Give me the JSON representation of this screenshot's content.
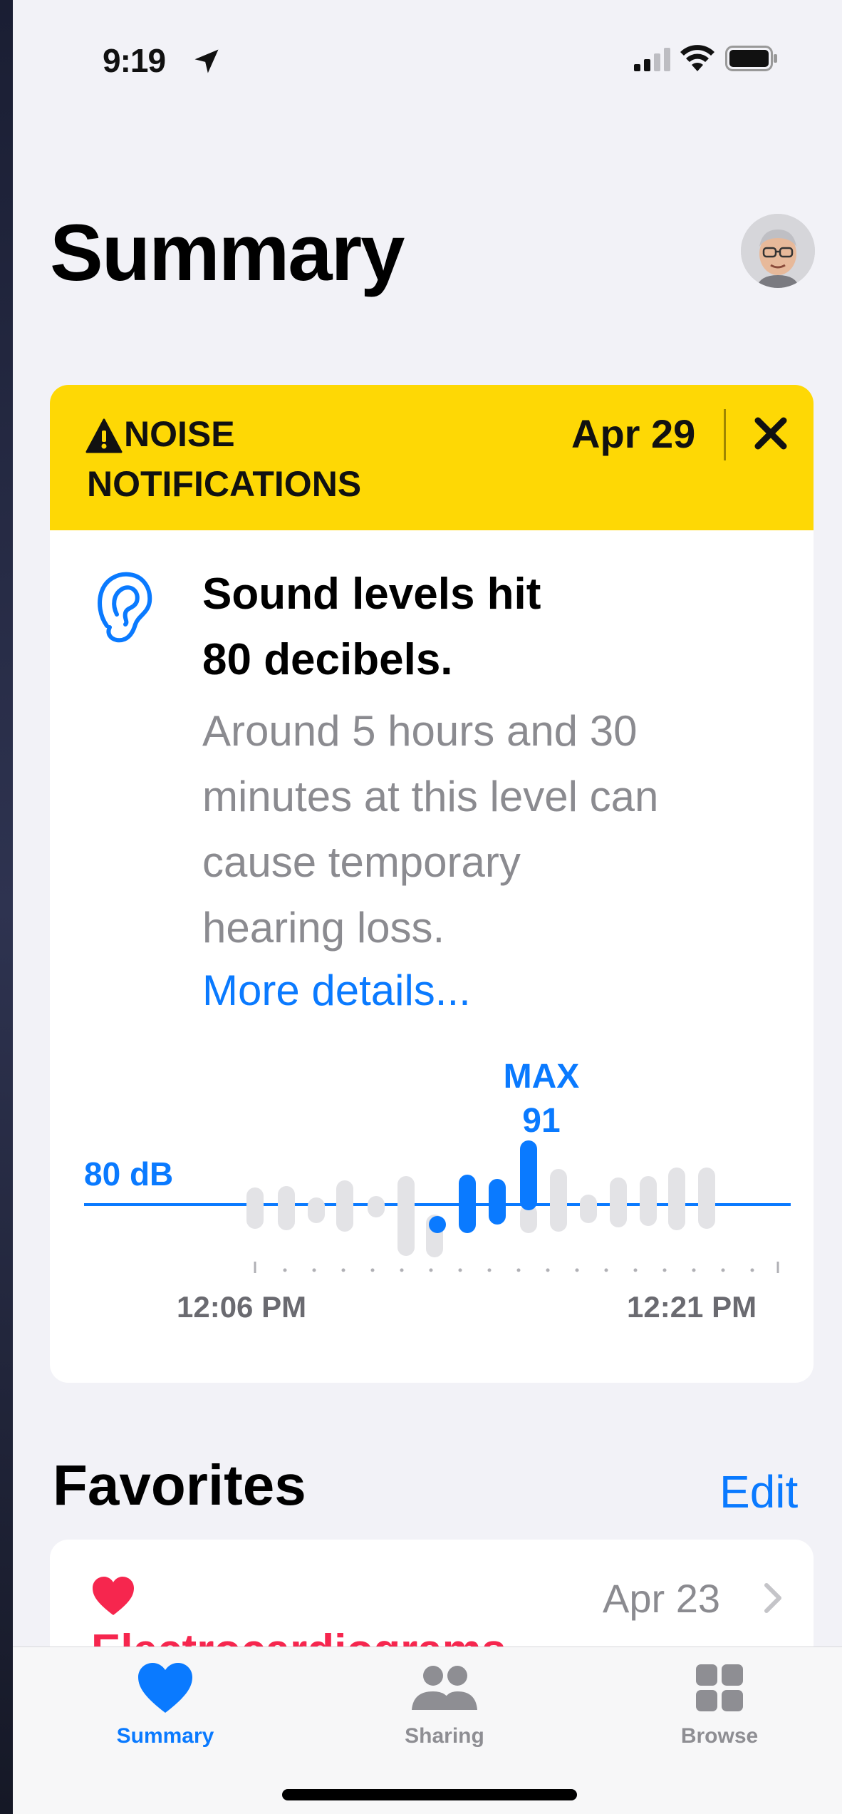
{
  "status_bar": {
    "time": "9:19",
    "icons": [
      "location-arrow-icon",
      "cellular-signal-icon",
      "wifi-icon",
      "battery-icon"
    ]
  },
  "header": {
    "title": "Summary",
    "avatar": "memoji-avatar"
  },
  "noise_card": {
    "banner": {
      "title_line1": "NOISE",
      "title_line2": "NOTIFICATIONS",
      "date": "Apr 29",
      "icons": [
        "warning-triangle-icon",
        "close-icon"
      ],
      "color": "#fed805"
    },
    "headline_line1": "Sound levels hit",
    "headline_line2": "80 decibels.",
    "description_lines": [
      "Around 5 hours and 30",
      "minutes at this level can",
      "cause temporary",
      "hearing loss."
    ],
    "more_link": "More details...",
    "chart": {
      "max_label": "MAX",
      "max_value": "91",
      "threshold_label": "80 dB",
      "start_time": "12:06 PM",
      "end_time": "12:21 PM"
    }
  },
  "favorites": {
    "title": "Favorites",
    "edit_label": "Edit",
    "items": [
      {
        "date": "Apr 23",
        "title": "Electrocardiograms",
        "icon": "heart-icon",
        "accent": "#f6264e"
      }
    ]
  },
  "tab_bar": {
    "tabs": [
      {
        "label": "Summary",
        "icon": "heart-fill-icon",
        "selected": true
      },
      {
        "label": "Sharing",
        "icon": "people-icon",
        "selected": false
      },
      {
        "label": "Browse",
        "icon": "grid-icon",
        "selected": false
      }
    ]
  },
  "colors": {
    "accent": "#0a7aff",
    "warning": "#fed805",
    "favorite": "#f6264e",
    "background": "#f2f2f7"
  }
}
